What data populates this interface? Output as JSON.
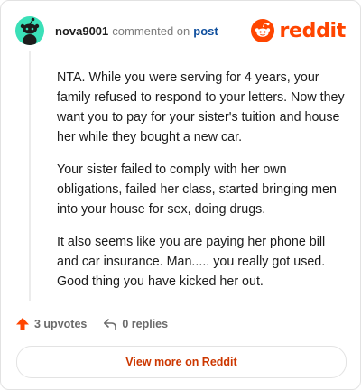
{
  "comment": {
    "username": "nova9001",
    "commented_text": "commented on",
    "post_link": "post",
    "avatar_icon": "snoo-avatar-icon",
    "avatar_color": "#3be0b8",
    "paragraphs": [
      "NTA. While you were serving for 4 years, your family refused to respond to your letters. Now they want you to pay for your sister's tuition and house her while they bought a new car.",
      "Your sister failed to comply with her own obligations, failed her class, started bringing men into your house for sex, doing drugs.",
      "It also seems like you are paying her phone bill and car insurance. Man..... you really got used. Good thing you have kicked her out."
    ]
  },
  "brand": {
    "name": "reddit",
    "icon": "reddit-logo-icon",
    "color": "#ff4500"
  },
  "actions": {
    "upvotes_label": "3 upvotes",
    "upvote_icon": "upvote-arrow-icon",
    "upvote_color": "#ff4500",
    "replies_label": "0 replies",
    "reply_icon": "reply-arrow-icon"
  },
  "footer": {
    "view_more_label": "View more on Reddit"
  }
}
